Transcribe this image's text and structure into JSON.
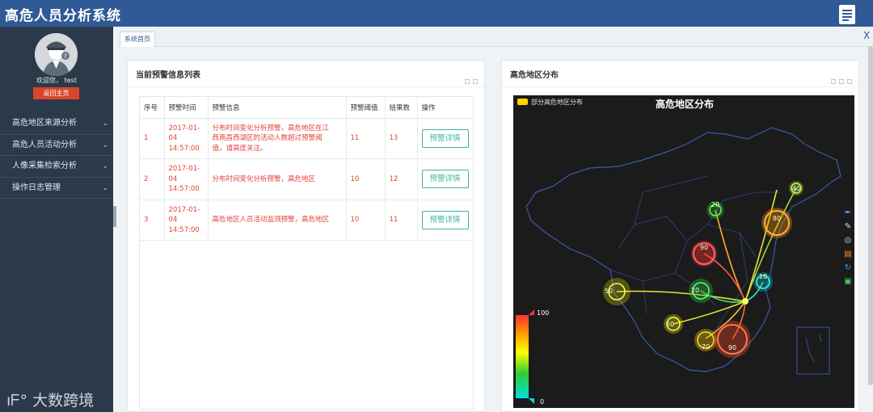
{
  "app": {
    "title": "高危人员分析系统",
    "doc_icon": "document-icon"
  },
  "user": {
    "welcome": "欢迎您， test",
    "home_button": "返回主页"
  },
  "sidebar": {
    "items": [
      {
        "label": "高危地区来源分析",
        "icon": "chevron-down-icon"
      },
      {
        "label": "高危人员活动分析",
        "icon": "chevron-down-icon"
      },
      {
        "label": "人像采集检索分析",
        "icon": "chevron-down-icon"
      },
      {
        "label": "操作日志管理",
        "icon": "chevron-down-icon"
      }
    ],
    "brand": "大数跨境",
    "brand_mark": "ıᖴ°"
  },
  "tabs": [
    {
      "label": "系统首页"
    }
  ],
  "tab_close": "X",
  "warning_panel": {
    "title": "当前预警信息列表",
    "columns": [
      "序号",
      "预警时间",
      "预警信息",
      "预警阈值",
      "结果数",
      "操作"
    ],
    "rows": [
      {
        "id": "1",
        "time": [
          "2017-01-",
          "04",
          "14:57:00"
        ],
        "info": [
          "分布时间变化分析预警，高危地区在江",
          "西南昌西湖区的活动人数超过预警阈",
          "值，请高度关注。"
        ],
        "threshold": "11",
        "count": "13",
        "action": "预警详情"
      },
      {
        "id": "2",
        "time": [
          "2017-01-",
          "04",
          "14:57:00"
        ],
        "info": [
          "分布时间变化分析预警，高危地区"
        ],
        "threshold": "10",
        "count": "12",
        "action": "预警详情"
      },
      {
        "id": "3",
        "time": [
          "2017-01-",
          "04",
          "14:57:00"
        ],
        "info": [
          "高危地区人员活动监测预警，高危地区"
        ],
        "threshold": "10",
        "count": "11",
        "action": "预警详情"
      }
    ]
  },
  "map_panel": {
    "panel_title": "高危地区分布",
    "map_title": "高危地区分布",
    "legend": "部分高危地区分布",
    "scale_max": "100",
    "scale_min": "0",
    "colors": {
      "low": "#00e0e0",
      "mid1": "#33cc33",
      "mid2": "#ffff00",
      "mid3": "#ff9900",
      "high": "#ff3333"
    },
    "markers": [
      {
        "label": "40",
        "value": 40
      },
      {
        "label": "20",
        "value": 20
      },
      {
        "label": "80",
        "value": 80
      },
      {
        "label": "90",
        "value": 90
      },
      {
        "label": "50",
        "value": 50
      },
      {
        "label": "20",
        "value": 20
      },
      {
        "label": "10",
        "value": 10
      },
      {
        "label": "60",
        "value": 60
      },
      {
        "label": "70",
        "value": 70
      },
      {
        "label": "90",
        "value": 90
      }
    ],
    "tools": [
      "pin-icon",
      "pencil-icon",
      "lasso-icon",
      "data-view-icon",
      "refresh-icon",
      "save-icon"
    ]
  }
}
